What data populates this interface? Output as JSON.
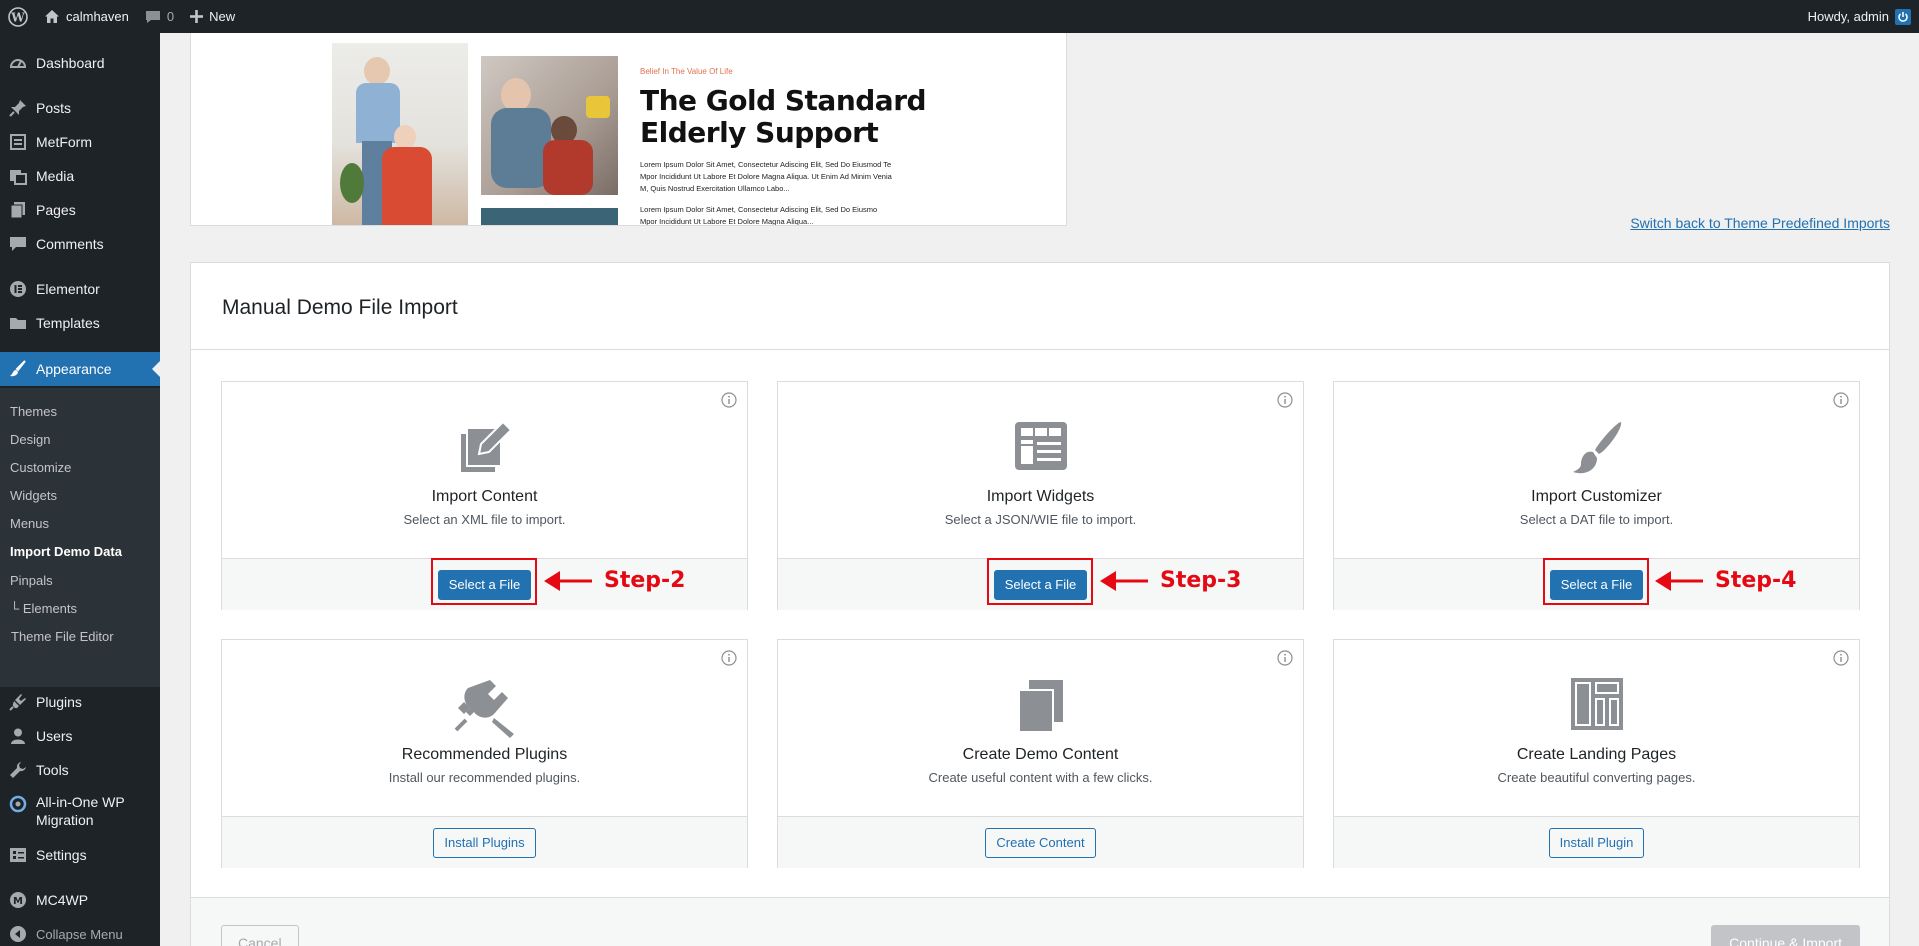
{
  "admin_bar": {
    "site_name": "calmhaven",
    "comments_count": "0",
    "new_label": "New",
    "greeting": "Howdy, admin"
  },
  "sidebar": {
    "items": [
      {
        "label": "Dashboard",
        "icon": "dashboard-icon"
      },
      {
        "label": "Posts",
        "icon": "pin-icon"
      },
      {
        "label": "MetForm",
        "icon": "form-icon"
      },
      {
        "label": "Media",
        "icon": "media-icon"
      },
      {
        "label": "Pages",
        "icon": "pages-icon"
      },
      {
        "label": "Comments",
        "icon": "comment-icon"
      },
      {
        "label": "Elementor",
        "icon": "elementor-icon"
      },
      {
        "label": "Templates",
        "icon": "folder-icon"
      },
      {
        "label": "Appearance",
        "icon": "brush-icon"
      },
      {
        "label": "Plugins",
        "icon": "plug-icon"
      },
      {
        "label": "Users",
        "icon": "user-icon"
      },
      {
        "label": "Tools",
        "icon": "wrench-icon"
      },
      {
        "label": "All-in-One WP Migration",
        "icon": "migration-icon"
      },
      {
        "label": "Settings",
        "icon": "settings-icon"
      },
      {
        "label": "MC4WP",
        "icon": "mc4wp-icon"
      },
      {
        "label": "Collapse Menu",
        "icon": "collapse-icon"
      }
    ],
    "submenu": [
      "Themes",
      "Design",
      "Customize",
      "Widgets",
      "Menus",
      "Import Demo Data",
      "Pinpals",
      "└ Elements",
      "Theme File Editor"
    ]
  },
  "preview": {
    "eyebrow": "Belief In The Value Of Life",
    "title_line1": "The Gold Standard",
    "title_line2": "Elderly Support",
    "para1_l1": "Lorem Ipsum Dolor Sit Amet, Consectetur Adiscing Elit, Sed Do Eiusmod Te",
    "para1_l2": "Mpor Incididunt Ut Labore Et Dolore Magna Aliqua. Ut Enim Ad Minim Venia",
    "para1_l3": "M, Quis Nostrud Exercitation Ullamco Labo...",
    "para2_l1": "Lorem Ipsum Dolor Sit Amet, Consectetur Adiscing Elit, Sed Do Eiusmo",
    "para2_l2": "Mpor Incididunt Ut Labore Et Dolore Magna Aliqua..."
  },
  "switch_link": "Switch back to Theme Predefined Imports",
  "panel": {
    "title": "Manual Demo File Import",
    "cancel_label": "Cancel",
    "continue_label": "Continue & Import"
  },
  "features": [
    {
      "title": "Import Content",
      "desc": "Select an XML file to import.",
      "button": "Select a File",
      "step": "Step-2"
    },
    {
      "title": "Import Widgets",
      "desc": "Select a JSON/WIE file to import.",
      "button": "Select a File",
      "step": "Step-3"
    },
    {
      "title": "Import Customizer",
      "desc": "Select a DAT file to import.",
      "button": "Select a File",
      "step": "Step-4"
    },
    {
      "title": "Recommended Plugins",
      "desc": "Install our recommended plugins.",
      "button": "Install Plugins"
    },
    {
      "title": "Create Demo Content",
      "desc": "Create useful content with a few clicks.",
      "button": "Create Content"
    },
    {
      "title": "Create Landing Pages",
      "desc": "Create beautiful converting pages.",
      "button": "Install Plugin"
    }
  ],
  "colors": {
    "admin_dark": "#1d2327",
    "accent": "#2271b1",
    "annotation_red": "#e50914"
  }
}
